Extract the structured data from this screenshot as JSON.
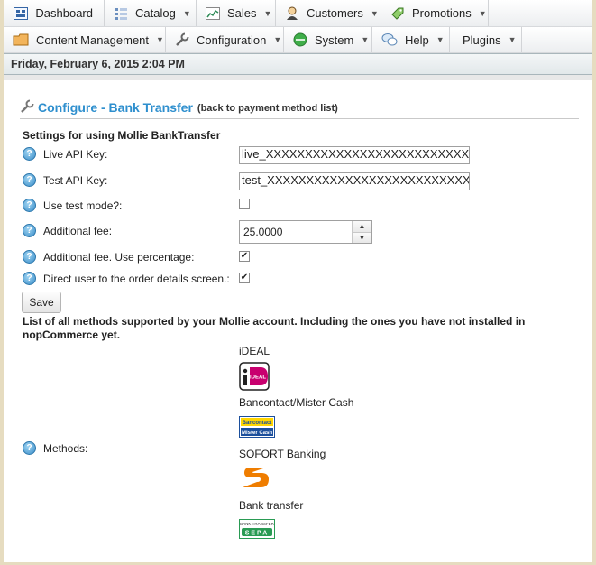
{
  "menu": {
    "row1": [
      {
        "label": "Dashboard",
        "icon": "dashboard-icon",
        "caret": false
      },
      {
        "label": "Catalog",
        "icon": "catalog-icon",
        "caret": true
      },
      {
        "label": "Sales",
        "icon": "sales-icon",
        "caret": true
      },
      {
        "label": "Customers",
        "icon": "customers-icon",
        "caret": true
      },
      {
        "label": "Promotions",
        "icon": "promotions-icon",
        "caret": true
      }
    ],
    "row2": [
      {
        "label": "Content Management",
        "icon": "content-management-icon",
        "caret": true
      },
      {
        "label": "Configuration",
        "icon": "configuration-icon",
        "caret": true
      },
      {
        "label": "System",
        "icon": "system-icon",
        "caret": true
      },
      {
        "label": "Help",
        "icon": "help-icon",
        "caret": true
      },
      {
        "label": "Plugins",
        "icon": "",
        "caret": true
      }
    ],
    "caret_glyph": "▼"
  },
  "date_bar": "Friday, February 6, 2015 2:04 PM",
  "page": {
    "title": "Configure - Bank Transfer",
    "back_link": "(back to payment method list)",
    "section_title": "Settings for using Mollie BankTransfer"
  },
  "form": {
    "live_api_key": {
      "label": "Live API Key:",
      "value": "live_XXXXXXXXXXXXXXXXXXXXXXXXXXXXXX"
    },
    "test_api_key": {
      "label": "Test API Key:",
      "value": "test_XXXXXXXXXXXXXXXXXXXXXXXXXXXXXX"
    },
    "use_test_mode": {
      "label": "Use test mode?:",
      "checked": false
    },
    "additional_fee": {
      "label": "Additional fee:",
      "value": "25.0000"
    },
    "fee_percentage": {
      "label": "Additional fee. Use percentage:",
      "checked": true
    },
    "direct_user": {
      "label": "Direct user to the order details screen.:",
      "checked": true
    },
    "save_label": "Save",
    "help_glyph": "?"
  },
  "methods_note": "List of all methods supported by your Mollie account. Including the ones you have not installed in nopCommerce yet.",
  "methods": {
    "label": "Methods:",
    "items": [
      {
        "name": "iDEAL",
        "logo": "ideal-logo"
      },
      {
        "name": "Bancontact/Mister Cash",
        "logo": "bancontact-logo"
      },
      {
        "name": "SOFORT Banking",
        "logo": "sofort-logo"
      },
      {
        "name": "Bank transfer",
        "logo": "bank-transfer-logo"
      }
    ]
  },
  "logo_text": {
    "ideal": "iDEAL",
    "bancontact_1": "Bancontact",
    "bancontact_2": "Mister Cash",
    "bank_transfer_1": "BANK TRANSFER",
    "bank_transfer_2": "SEPA"
  },
  "colors": {
    "accent": "#2e8fce",
    "frame": "#e6dcc0",
    "ideal": "#c8006f",
    "sofort": "#ef7d00",
    "bank_transfer": "#2a9b54"
  }
}
